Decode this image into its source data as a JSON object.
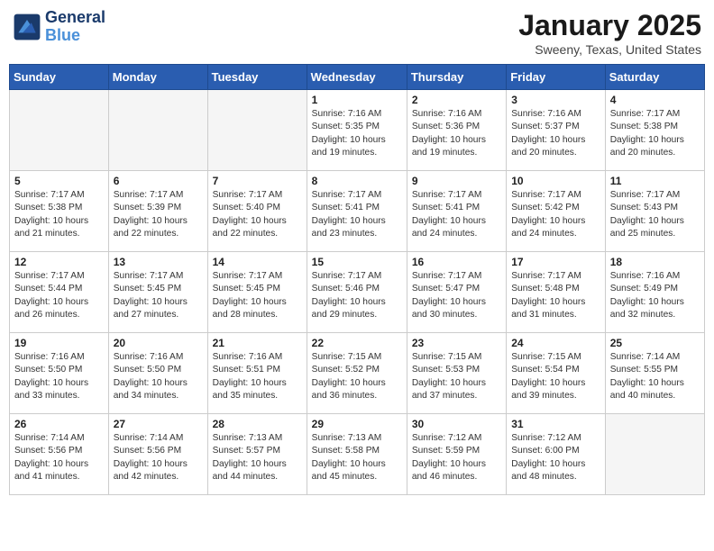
{
  "logo": {
    "line1": "General",
    "line2": "Blue"
  },
  "header": {
    "month_year": "January 2025",
    "location": "Sweeny, Texas, United States"
  },
  "days_of_week": [
    "Sunday",
    "Monday",
    "Tuesday",
    "Wednesday",
    "Thursday",
    "Friday",
    "Saturday"
  ],
  "weeks": [
    [
      {
        "num": "",
        "info": ""
      },
      {
        "num": "",
        "info": ""
      },
      {
        "num": "",
        "info": ""
      },
      {
        "num": "1",
        "info": "Sunrise: 7:16 AM\nSunset: 5:35 PM\nDaylight: 10 hours\nand 19 minutes."
      },
      {
        "num": "2",
        "info": "Sunrise: 7:16 AM\nSunset: 5:36 PM\nDaylight: 10 hours\nand 19 minutes."
      },
      {
        "num": "3",
        "info": "Sunrise: 7:16 AM\nSunset: 5:37 PM\nDaylight: 10 hours\nand 20 minutes."
      },
      {
        "num": "4",
        "info": "Sunrise: 7:17 AM\nSunset: 5:38 PM\nDaylight: 10 hours\nand 20 minutes."
      }
    ],
    [
      {
        "num": "5",
        "info": "Sunrise: 7:17 AM\nSunset: 5:38 PM\nDaylight: 10 hours\nand 21 minutes."
      },
      {
        "num": "6",
        "info": "Sunrise: 7:17 AM\nSunset: 5:39 PM\nDaylight: 10 hours\nand 22 minutes."
      },
      {
        "num": "7",
        "info": "Sunrise: 7:17 AM\nSunset: 5:40 PM\nDaylight: 10 hours\nand 22 minutes."
      },
      {
        "num": "8",
        "info": "Sunrise: 7:17 AM\nSunset: 5:41 PM\nDaylight: 10 hours\nand 23 minutes."
      },
      {
        "num": "9",
        "info": "Sunrise: 7:17 AM\nSunset: 5:41 PM\nDaylight: 10 hours\nand 24 minutes."
      },
      {
        "num": "10",
        "info": "Sunrise: 7:17 AM\nSunset: 5:42 PM\nDaylight: 10 hours\nand 24 minutes."
      },
      {
        "num": "11",
        "info": "Sunrise: 7:17 AM\nSunset: 5:43 PM\nDaylight: 10 hours\nand 25 minutes."
      }
    ],
    [
      {
        "num": "12",
        "info": "Sunrise: 7:17 AM\nSunset: 5:44 PM\nDaylight: 10 hours\nand 26 minutes."
      },
      {
        "num": "13",
        "info": "Sunrise: 7:17 AM\nSunset: 5:45 PM\nDaylight: 10 hours\nand 27 minutes."
      },
      {
        "num": "14",
        "info": "Sunrise: 7:17 AM\nSunset: 5:45 PM\nDaylight: 10 hours\nand 28 minutes."
      },
      {
        "num": "15",
        "info": "Sunrise: 7:17 AM\nSunset: 5:46 PM\nDaylight: 10 hours\nand 29 minutes."
      },
      {
        "num": "16",
        "info": "Sunrise: 7:17 AM\nSunset: 5:47 PM\nDaylight: 10 hours\nand 30 minutes."
      },
      {
        "num": "17",
        "info": "Sunrise: 7:17 AM\nSunset: 5:48 PM\nDaylight: 10 hours\nand 31 minutes."
      },
      {
        "num": "18",
        "info": "Sunrise: 7:16 AM\nSunset: 5:49 PM\nDaylight: 10 hours\nand 32 minutes."
      }
    ],
    [
      {
        "num": "19",
        "info": "Sunrise: 7:16 AM\nSunset: 5:50 PM\nDaylight: 10 hours\nand 33 minutes."
      },
      {
        "num": "20",
        "info": "Sunrise: 7:16 AM\nSunset: 5:50 PM\nDaylight: 10 hours\nand 34 minutes."
      },
      {
        "num": "21",
        "info": "Sunrise: 7:16 AM\nSunset: 5:51 PM\nDaylight: 10 hours\nand 35 minutes."
      },
      {
        "num": "22",
        "info": "Sunrise: 7:15 AM\nSunset: 5:52 PM\nDaylight: 10 hours\nand 36 minutes."
      },
      {
        "num": "23",
        "info": "Sunrise: 7:15 AM\nSunset: 5:53 PM\nDaylight: 10 hours\nand 37 minutes."
      },
      {
        "num": "24",
        "info": "Sunrise: 7:15 AM\nSunset: 5:54 PM\nDaylight: 10 hours\nand 39 minutes."
      },
      {
        "num": "25",
        "info": "Sunrise: 7:14 AM\nSunset: 5:55 PM\nDaylight: 10 hours\nand 40 minutes."
      }
    ],
    [
      {
        "num": "26",
        "info": "Sunrise: 7:14 AM\nSunset: 5:56 PM\nDaylight: 10 hours\nand 41 minutes."
      },
      {
        "num": "27",
        "info": "Sunrise: 7:14 AM\nSunset: 5:56 PM\nDaylight: 10 hours\nand 42 minutes."
      },
      {
        "num": "28",
        "info": "Sunrise: 7:13 AM\nSunset: 5:57 PM\nDaylight: 10 hours\nand 44 minutes."
      },
      {
        "num": "29",
        "info": "Sunrise: 7:13 AM\nSunset: 5:58 PM\nDaylight: 10 hours\nand 45 minutes."
      },
      {
        "num": "30",
        "info": "Sunrise: 7:12 AM\nSunset: 5:59 PM\nDaylight: 10 hours\nand 46 minutes."
      },
      {
        "num": "31",
        "info": "Sunrise: 7:12 AM\nSunset: 6:00 PM\nDaylight: 10 hours\nand 48 minutes."
      },
      {
        "num": "",
        "info": ""
      }
    ]
  ]
}
